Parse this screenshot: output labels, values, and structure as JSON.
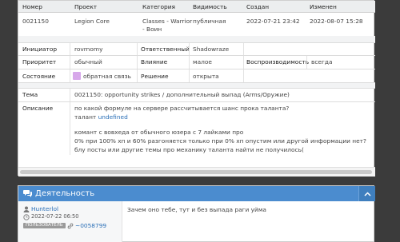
{
  "table": {
    "header": [
      "Номер",
      "Проект",
      "Категория",
      "Видимость",
      "Создан",
      "Изменен"
    ],
    "row": {
      "id": "0021150",
      "project": "Legion Core",
      "category_line1": "Classes - Warrior",
      "category_line2": "- Воин",
      "visibility": "публичная",
      "created": "2022-07-21 23:42",
      "modified": "2022-08-07 15:28"
    }
  },
  "details": {
    "reporter_label": "Инициатор",
    "reporter": "rovrnomy",
    "assigned_label": "Ответственный",
    "assigned": "Shadowraze",
    "priority_label": "Приоритет",
    "priority": "обычный",
    "severity_label": "Влияние",
    "severity": "малое",
    "reproducibility_label": "Воспроизводимость",
    "reproducibility": "всегда",
    "status_label": "Состояние",
    "status": "обратная связь",
    "resolution_label": "Решение",
    "resolution": "открыта",
    "summary_label": "Тема",
    "summary": "0021150: opportunity strikes / дополнительный выпад (Arms/Оружие)",
    "description_label": "Описание",
    "description": {
      "line1": "по какой формуле на сервере рассчитывается шанс прока таланта?",
      "line2_prefix": "талант ",
      "line2_link": "undefined",
      "line3": "комант с вовхеда от обычного юзера с 7 лайками про",
      "line4": "0% при 100% хп и 60% разгоняется только при 0% хп опустим или другой информации нет?",
      "line5": "блу посты или другие темы про механику таланта найти не получилось("
    }
  },
  "activity": {
    "title": "Деятельность",
    "note": {
      "author": "Hunterlol",
      "date": "2022-07-22 06:50",
      "role": "ПОЛЬЗОВАТЕЛЬ",
      "note_id": "~0058799",
      "text": "Зачем оно тебе, тут и без выпада раги уйма"
    }
  },
  "colors": {
    "status_feedback": "#d7a8ea",
    "activity_header": "#4b8ccf",
    "link": "#2a6fb7"
  },
  "icons": {
    "activity": "comments-icon",
    "collapse": "chevron-up-icon",
    "user": "user-icon",
    "clock": "clock-icon",
    "note_link": "link-icon"
  }
}
